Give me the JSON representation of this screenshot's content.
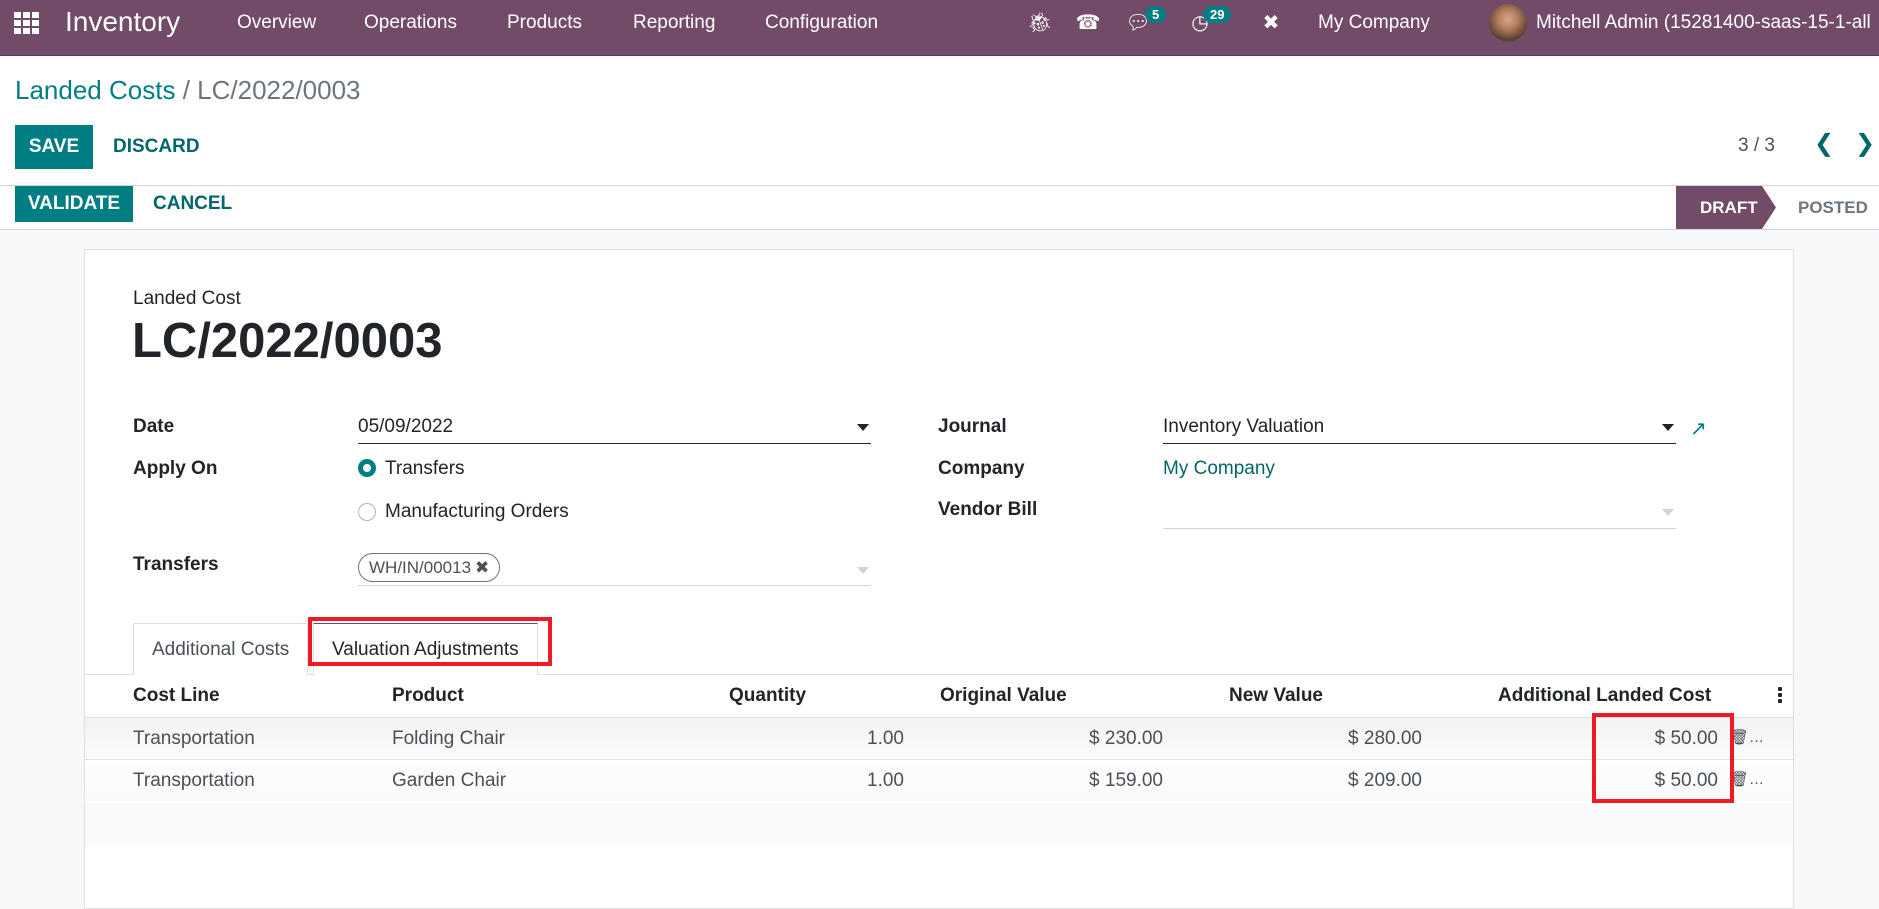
{
  "navbar": {
    "app_name": "Inventory",
    "menu": [
      "Overview",
      "Operations",
      "Products",
      "Reporting",
      "Configuration"
    ],
    "messages_badge": "5",
    "activities_badge": "29",
    "company": "My Company",
    "user": "Mitchell Admin (15281400-saas-15-1-all",
    "bg_color": "#714b67"
  },
  "breadcrumb": {
    "parent": "Landed Costs",
    "separator": "/",
    "current": "LC/2022/0003"
  },
  "actions": {
    "save": "SAVE",
    "discard": "DISCARD",
    "validate": "VALIDATE",
    "cancel": "CANCEL"
  },
  "pager": {
    "value": "3 / 3"
  },
  "status": {
    "stages": [
      "DRAFT",
      "POSTED"
    ],
    "current": "DRAFT"
  },
  "form": {
    "record_label": "Landed Cost",
    "record_name": "LC/2022/0003",
    "date_label": "Date",
    "date_value": "05/09/2022",
    "apply_on_label": "Apply On",
    "apply_on_options": [
      "Transfers",
      "Manufacturing Orders"
    ],
    "apply_on_selected": "Transfers",
    "transfers_label": "Transfers",
    "transfers_tags": [
      "WH/IN/00013"
    ],
    "journal_label": "Journal",
    "journal_value": "Inventory Valuation",
    "company_label": "Company",
    "company_value": "My Company",
    "vendor_bill_label": "Vendor Bill",
    "vendor_bill_value": ""
  },
  "tabs": [
    {
      "label": "Additional Costs",
      "active": false
    },
    {
      "label": "Valuation Adjustments",
      "active": true
    }
  ],
  "table": {
    "columns": [
      "Cost Line",
      "Product",
      "Quantity",
      "Original Value",
      "New Value",
      "Additional Landed Cost"
    ],
    "rows": [
      {
        "cost_line": "Transportation",
        "product": "Folding Chair",
        "quantity": "1.00",
        "original_value": "$ 230.00",
        "new_value": "$ 280.00",
        "additional_landed_cost": "$ 50.00"
      },
      {
        "cost_line": "Transportation",
        "product": "Garden Chair",
        "quantity": "1.00",
        "original_value": "$ 159.00",
        "new_value": "$ 209.00",
        "additional_landed_cost": "$ 50.00"
      }
    ]
  },
  "colors": {
    "primary": "#017e84",
    "brand": "#714b67",
    "highlight": "#ed1c24"
  }
}
